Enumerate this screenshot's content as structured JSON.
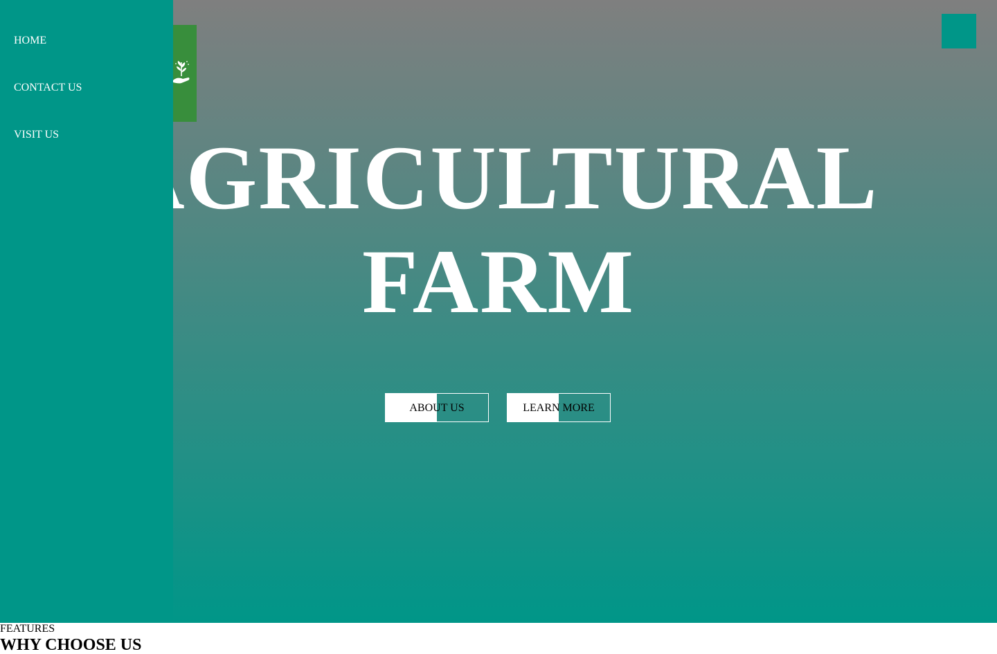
{
  "nav": {
    "items": [
      {
        "label": "HOME"
      },
      {
        "label": "CONTACT US"
      },
      {
        "label": "VISIT US"
      }
    ]
  },
  "hero": {
    "logo_icon": "hand-holding-plant-icon",
    "menu_icon": "menu-toggle",
    "title_line1": "AGRICULTURAL",
    "title_line2": "FARM",
    "subtitle": "",
    "buttons": {
      "about_label": "ABOUT US",
      "learn_label": "LEARN MORE"
    }
  },
  "features": {
    "label": "FEATURES",
    "heading": "WHY CHOOSE US"
  },
  "colors": {
    "accent": "#009688",
    "logo_bg": "#388e3c",
    "hero_gradient_top": "#7f7f7f",
    "hero_gradient_bottom": "#009688"
  }
}
